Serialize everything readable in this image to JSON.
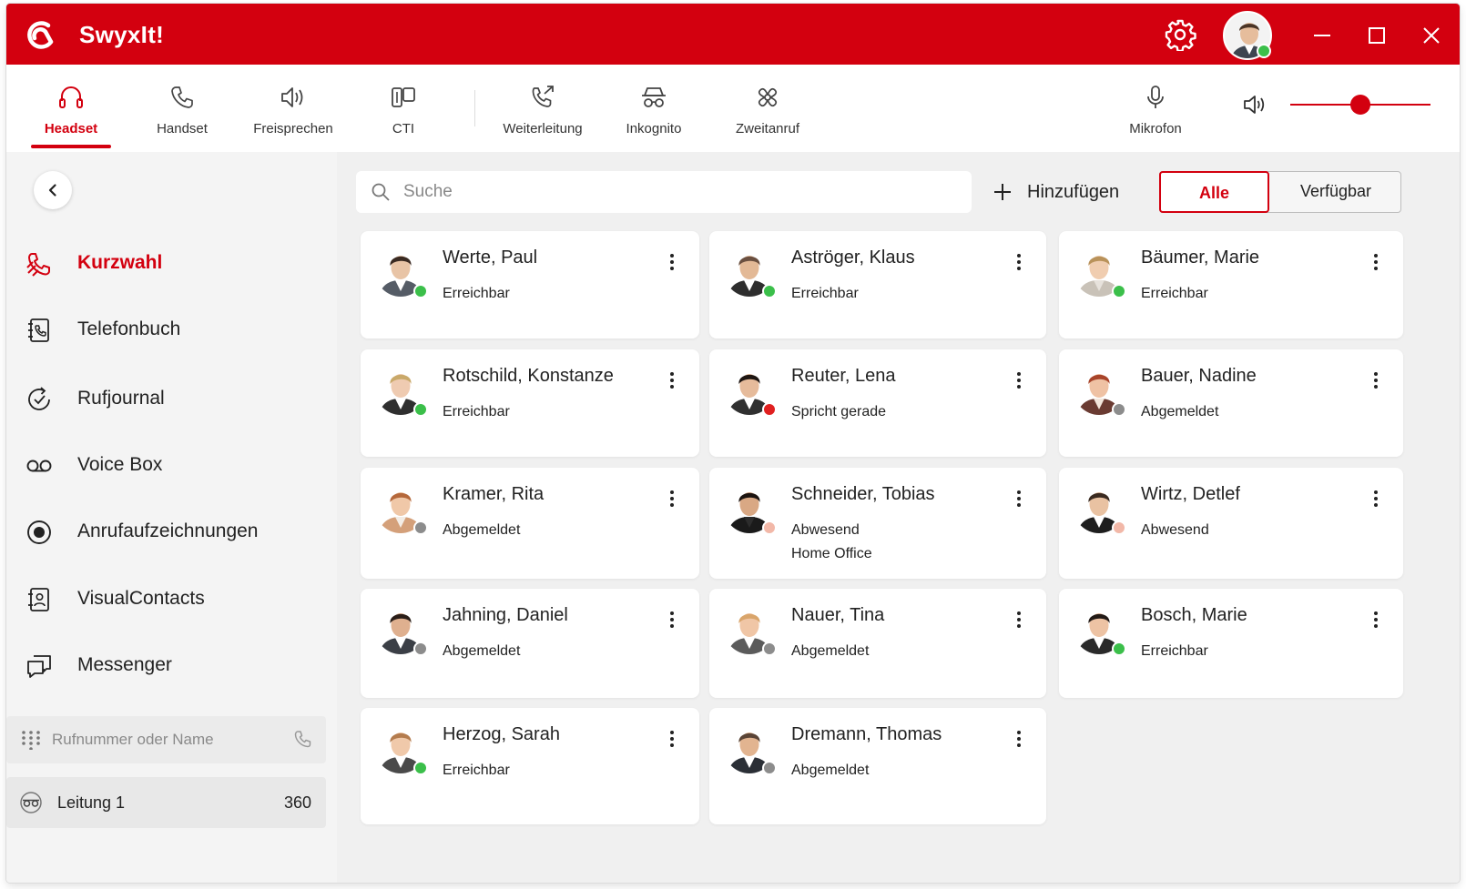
{
  "app": {
    "name": "SwyxIt!",
    "accent_color": "#d3000f"
  },
  "titlebar": {
    "settings_icon": "gear-icon",
    "user_status_color": "#3bbf4a",
    "window_buttons": [
      "minimize-icon",
      "maximize-icon",
      "close-icon"
    ]
  },
  "toolbar": {
    "tools": [
      {
        "id": "headset",
        "label": "Headset",
        "icon": "headset-icon",
        "active": true
      },
      {
        "id": "handset",
        "label": "Handset",
        "icon": "handset-icon",
        "active": false
      },
      {
        "id": "freisprechen",
        "label": "Freisprechen",
        "icon": "speaker-icon",
        "active": false
      },
      {
        "id": "cti",
        "label": "CTI",
        "icon": "cti-icon",
        "active": false
      },
      {
        "id": "weiterleitung",
        "label": "Weiterleitung",
        "icon": "call-forward-icon",
        "active": false
      },
      {
        "id": "inkognito",
        "label": "Inkognito",
        "icon": "incognito-icon",
        "active": false
      },
      {
        "id": "zweitanruf",
        "label": "Zweitanruf",
        "icon": "second-call-icon",
        "active": false
      }
    ],
    "microphone_label": "Mikrofon",
    "volume_level": 0.5
  },
  "sidebar": {
    "items": [
      {
        "id": "kurzwahl",
        "label": "Kurzwahl",
        "icon": "speed-dial-icon",
        "active": true
      },
      {
        "id": "telefonbuch",
        "label": "Telefonbuch",
        "icon": "phonebook-icon",
        "active": false
      },
      {
        "id": "rufjournal",
        "label": "Rufjournal",
        "icon": "call-journal-icon",
        "active": false
      },
      {
        "id": "voicebox",
        "label": "Voice Box",
        "icon": "voicemail-icon",
        "active": false
      },
      {
        "id": "anrufaufzeichnungen",
        "label": "Anrufaufzeichnungen",
        "icon": "record-icon",
        "active": false
      },
      {
        "id": "visualcontacts",
        "label": "VisualContacts",
        "icon": "contacts-icon",
        "active": false
      },
      {
        "id": "messenger",
        "label": "Messenger",
        "icon": "messenger-icon",
        "active": false
      }
    ],
    "dial_placeholder": "Rufnummer oder Name",
    "line": {
      "label": "Leitung 1",
      "number": "360"
    }
  },
  "main": {
    "search_placeholder": "Suche",
    "add_label": "Hinzufügen",
    "filters": {
      "all": "Alle",
      "available": "Verfügbar"
    }
  },
  "status_colors": {
    "online": "#3bbf4a",
    "busy": "#e02020",
    "offline": "#8c8c8c",
    "away": "#f2b8a8"
  },
  "contacts": [
    {
      "name": "Werte, Paul",
      "status": "Erreichbar",
      "state": "online",
      "note": "",
      "skin": "#e8c4a6",
      "hair": "#3a2a22",
      "shirt": "#ffffff",
      "jacket": "#555c66"
    },
    {
      "name": "Aströger, Klaus",
      "status": "Erreichbar",
      "state": "online",
      "note": "",
      "skin": "#e3b996",
      "hair": "#6b5040",
      "shirt": "#ffffff",
      "jacket": "#2e2e2e"
    },
    {
      "name": "Bäumer, Marie",
      "status": "Erreichbar",
      "state": "online",
      "note": "",
      "skin": "#f0cdb0",
      "hair": "#b9925a",
      "shirt": "#e7e2dc",
      "jacket": "#c9c2b8"
    },
    {
      "name": "Rotschild, Konstanze",
      "status": "Erreichbar",
      "state": "online",
      "note": "",
      "skin": "#efcbb1",
      "hair": "#c9a96a",
      "shirt": "#ffffff",
      "jacket": "#2f2f2f"
    },
    {
      "name": "Reuter, Lena",
      "status": "Spricht gerade",
      "state": "busy",
      "note": "",
      "skin": "#e6bb9b",
      "hair": "#1e1612",
      "shirt": "#ffffff",
      "jacket": "#303030"
    },
    {
      "name": "Bauer, Nadine",
      "status": "Abgemeldet",
      "state": "offline",
      "note": "",
      "skin": "#efc2a4",
      "hair": "#a8442a",
      "shirt": "#f2e6dc",
      "jacket": "#6a3b32"
    },
    {
      "name": "Kramer, Rita",
      "status": "Abgemeldet",
      "state": "offline",
      "note": "",
      "skin": "#f0c8a8",
      "hair": "#b5683b",
      "shirt": "#f3ede6",
      "jacket": "#d4a07a"
    },
    {
      "name": "Schneider, Tobias",
      "status": "Abwesend",
      "state": "away",
      "note": "Home Office",
      "skin": "#d9a884",
      "hair": "#1c1410",
      "shirt": "#2c2c2c",
      "jacket": "#1a1a1a"
    },
    {
      "name": "Wirtz, Detlef",
      "status": "Abwesend",
      "state": "away",
      "note": "",
      "skin": "#e9c2a2",
      "hair": "#3a2a20",
      "shirt": "#ffffff",
      "jacket": "#1e1e1e"
    },
    {
      "name": "Jahning, Daniel",
      "status": "Abgemeldet",
      "state": "offline",
      "note": "",
      "skin": "#dfb08f",
      "hair": "#2a1e18",
      "shirt": "#ffffff",
      "jacket": "#3b3f46"
    },
    {
      "name": "Nauer, Tina",
      "status": "Abgemeldet",
      "state": "offline",
      "note": "",
      "skin": "#f0c6a6",
      "hair": "#d9a56b",
      "shirt": "#ffffff",
      "jacket": "#5b5b5b"
    },
    {
      "name": "Bosch, Marie",
      "status": "Erreichbar",
      "state": "online",
      "note": "",
      "skin": "#edc3a4",
      "hair": "#221a16",
      "shirt": "#ffffff",
      "jacket": "#2a2a2a"
    },
    {
      "name": "Herzog, Sarah",
      "status": "Erreichbar",
      "state": "online",
      "note": "",
      "skin": "#f0c9aa",
      "hair": "#b47c4e",
      "shirt": "#ffffff",
      "jacket": "#4a4a4a"
    },
    {
      "name": "Dremann, Thomas",
      "status": "Abgemeldet",
      "state": "offline",
      "note": "",
      "skin": "#e2b490",
      "hair": "#5a4436",
      "shirt": "#ffffff",
      "jacket": "#2b2f36"
    }
  ]
}
